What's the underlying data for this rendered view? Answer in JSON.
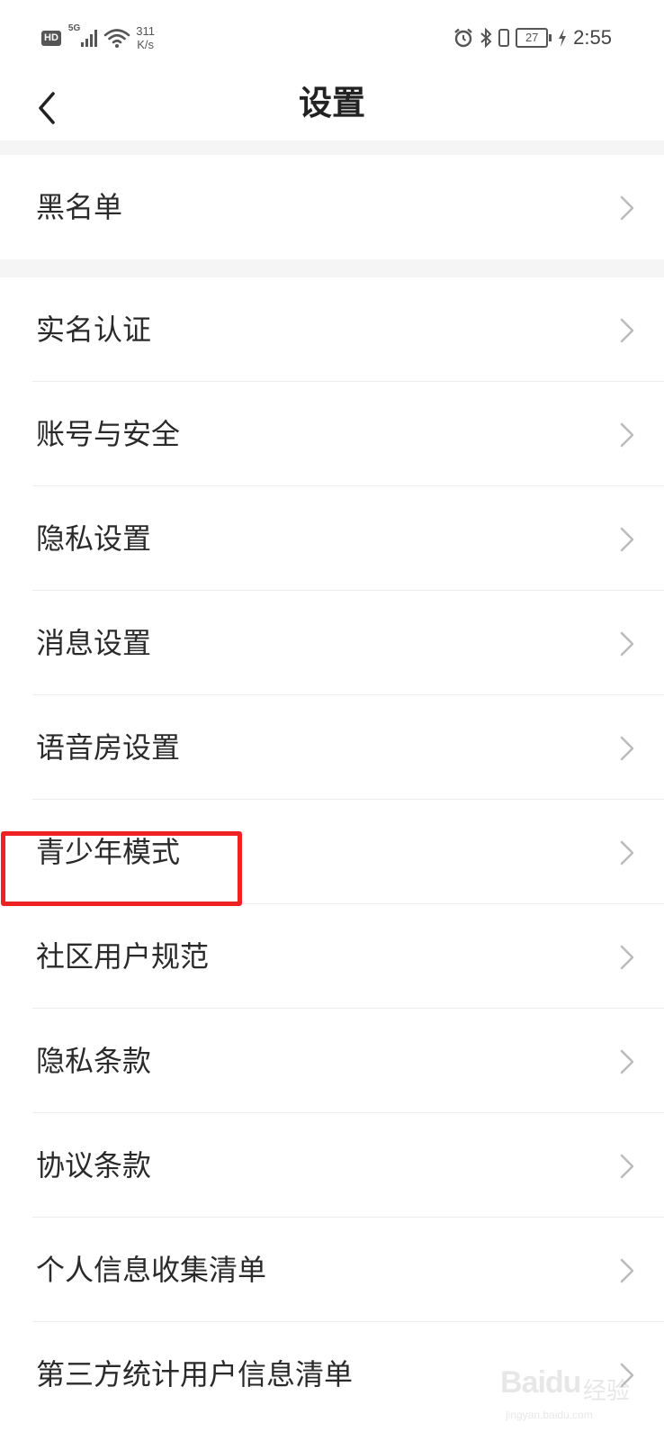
{
  "status_bar": {
    "hd_badge": "HD",
    "network": "5G",
    "speed_value": "311",
    "speed_unit": "K/s",
    "battery_level": "27",
    "time": "2:55",
    "icons": [
      "signal-icon",
      "wifi-icon",
      "alarm-icon",
      "bluetooth-icon",
      "vibrate-icon",
      "battery-icon",
      "charging-icon"
    ]
  },
  "header": {
    "title": "设置",
    "back_icon": "chevron-left-icon"
  },
  "settings": {
    "group1": [
      {
        "label": "黑名单"
      }
    ],
    "group2": [
      {
        "label": "实名认证"
      },
      {
        "label": "账号与安全"
      },
      {
        "label": "隐私设置"
      },
      {
        "label": "消息设置"
      },
      {
        "label": "语音房设置"
      },
      {
        "label": "青少年模式",
        "highlighted": true
      },
      {
        "label": "社区用户规范"
      },
      {
        "label": "隐私条款"
      },
      {
        "label": "协议条款"
      },
      {
        "label": "个人信息收集清单"
      },
      {
        "label": "第三方统计用户信息清单"
      }
    ]
  },
  "annotation": {
    "highlight_color": "#ee2222"
  },
  "watermark": {
    "brand": "Baidu",
    "sub": "经验",
    "url": "jingyan.baidu.com"
  },
  "colors": {
    "background": "#ffffff",
    "section_gap": "#f5f5f5",
    "text": "#222222",
    "chevron": "#bbbbbb"
  }
}
